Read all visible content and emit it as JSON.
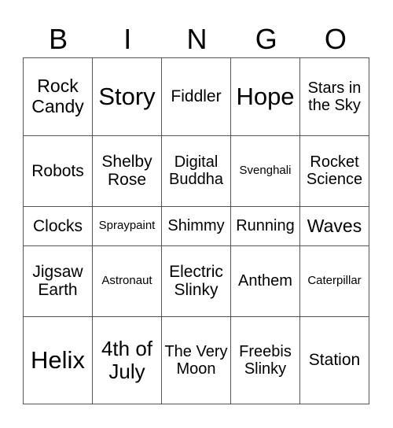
{
  "header": [
    "B",
    "I",
    "N",
    "G",
    "O"
  ],
  "cells": [
    [
      "Rock Candy",
      "Story",
      "Fiddler",
      "Hope",
      "Stars in the Sky"
    ],
    [
      "Robots",
      "Shelby Rose",
      "Digital Buddha",
      "Svenghali",
      "Rocket Science"
    ],
    [
      "Clocks",
      "Spraypaint",
      "Shimmy",
      "Running",
      "Waves"
    ],
    [
      "Jigsaw Earth",
      "Astronaut",
      "Electric Slinky",
      "Anthem",
      "Caterpillar"
    ],
    [
      "Helix",
      "4th of July",
      "The Very Moon",
      "Freebis Slinky",
      "Station"
    ]
  ]
}
